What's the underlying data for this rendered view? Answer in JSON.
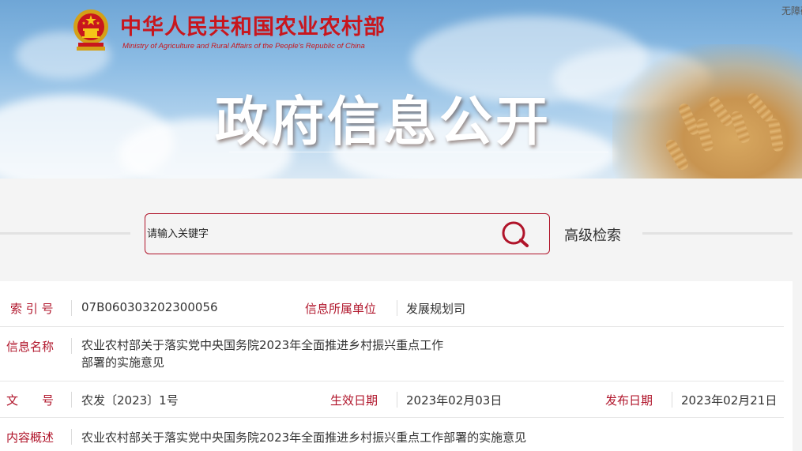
{
  "header": {
    "ministry_cn": "中华人民共和国农业农村部",
    "ministry_en": "Ministry of Agriculture and Rural Affairs of the People's Republic of China",
    "accessibility": "无障碍",
    "banner_title": "政府信息公开"
  },
  "search": {
    "placeholder": "请输入关键字",
    "advanced_label": "高级检索"
  },
  "info": {
    "index_label": "索 引 号",
    "index_value": "07B060303202300056",
    "unit_label": "信息所属单位",
    "unit_value": "发展规划司",
    "name_label": "信息名称",
    "name_value": "农业农村部关于落实党中央国务院2023年全面推进乡村振兴重点工作部署的实施意见",
    "doc_label": "文　　号",
    "doc_value": "农发〔2023〕1号",
    "effective_label": "生效日期",
    "effective_value": "2023年02月03日",
    "publish_label": "发布日期",
    "publish_value": "2023年02月21日",
    "summary_label": "内容概述",
    "summary_value": "农业农村部关于落实党中央国务院2023年全面推进乡村振兴重点工作部署的实施意见"
  },
  "colors": {
    "brand_red": "#c8161d",
    "label_red": "#b0142a"
  },
  "icons": {
    "emblem": "national-emblem-icon",
    "search": "search-icon"
  }
}
